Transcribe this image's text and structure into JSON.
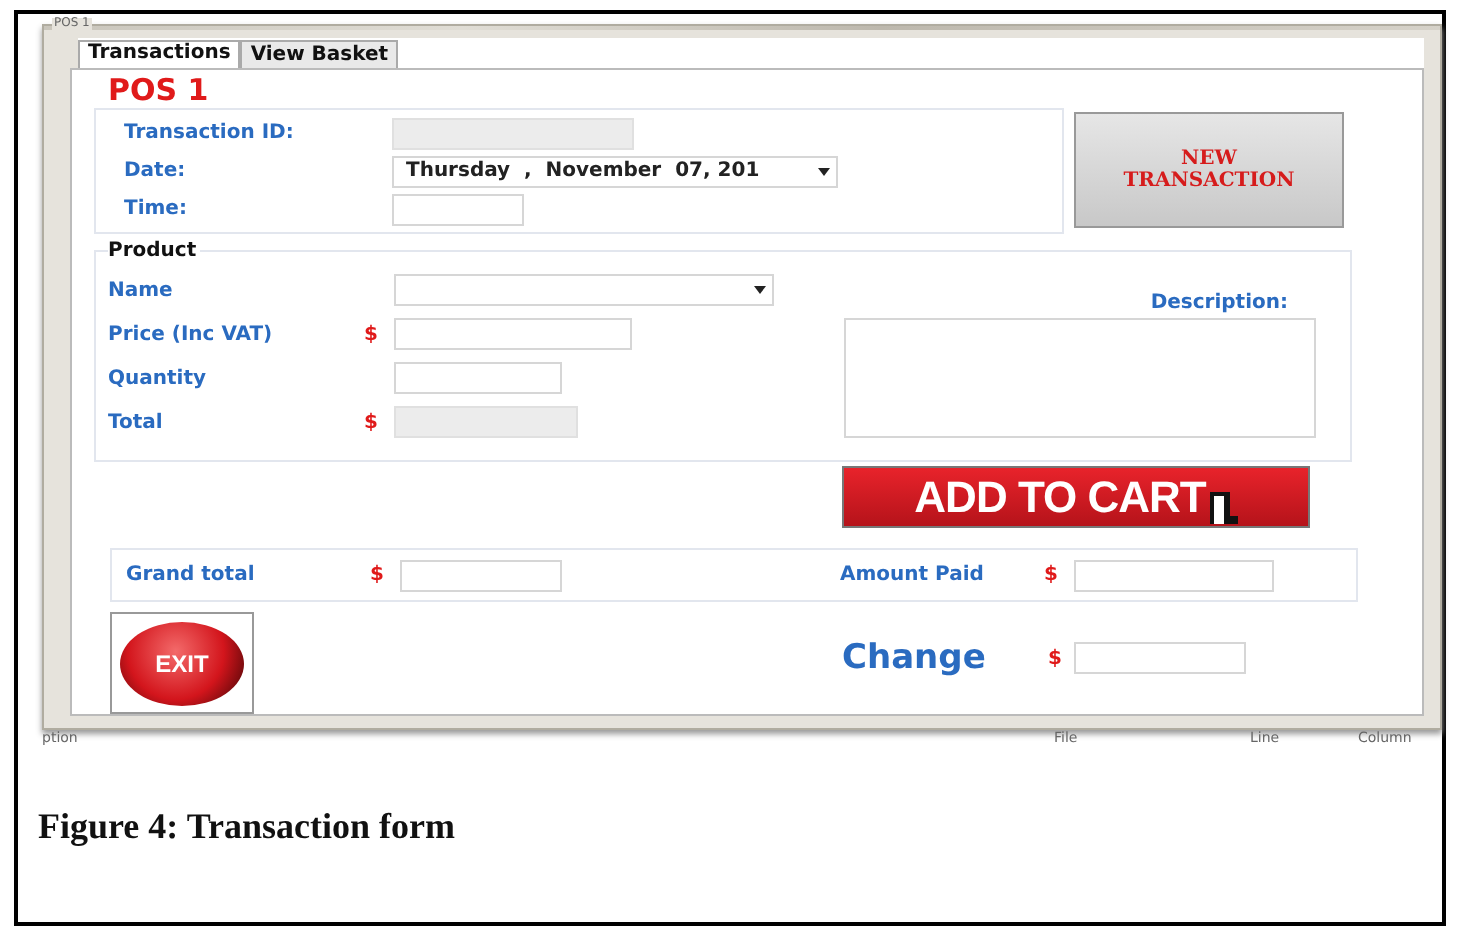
{
  "window": {
    "title": "POS 1"
  },
  "tabs": [
    {
      "label": "Transactions",
      "selected": true
    },
    {
      "label": "View Basket",
      "selected": false
    }
  ],
  "heading": "POS 1",
  "transaction": {
    "fields": [
      {
        "label": "Transaction ID:",
        "kind": "readonly"
      },
      {
        "label": "Date:",
        "kind": "date",
        "value": "Thursday  ,  November  07, 201"
      },
      {
        "label": "Time:",
        "kind": "text"
      }
    ],
    "new_button": "NEW TRANSACTION"
  },
  "product": {
    "legend": "Product",
    "fields": [
      {
        "label": "Name",
        "kind": "dropdown"
      },
      {
        "label": "Price (Inc VAT)",
        "kind": "money",
        "currency": "$"
      },
      {
        "label": "Quantity",
        "kind": "text"
      },
      {
        "label": "Total",
        "kind": "money_readonly",
        "currency": "$"
      }
    ],
    "description_label": "Description:",
    "add_button": "ADD TO CART"
  },
  "totals": {
    "grand_total": {
      "label": "Grand total",
      "currency": "$"
    },
    "amount_paid": {
      "label": "Amount Paid",
      "currency": "$"
    }
  },
  "change": {
    "label": "Change",
    "currency": "$"
  },
  "exit_button": "EXIT",
  "status_bar": {
    "columns": [
      "ption",
      "File",
      "Line",
      "Column"
    ]
  },
  "caption": "Figure 4: Transaction form"
}
